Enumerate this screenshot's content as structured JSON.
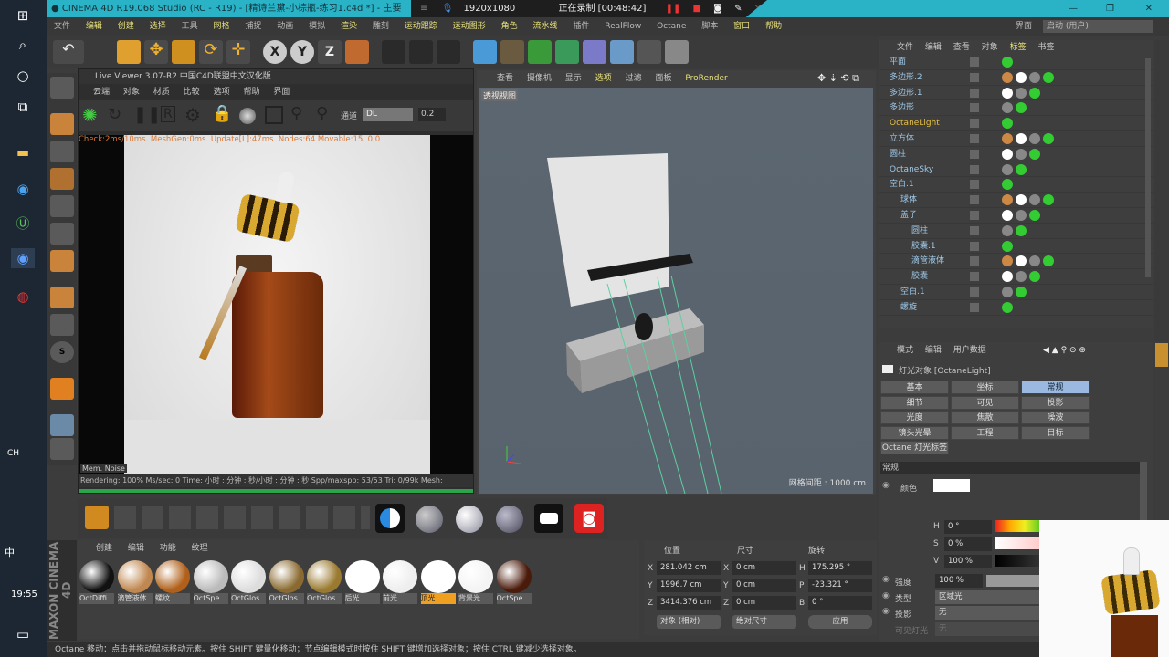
{
  "taskbar": {
    "time": "19:55",
    "ime": "中",
    "lang_hint": "CH"
  },
  "titlebar": {
    "title": "CINEMA 4D R19.068 Studio (RC - R19) - [精诗兰黛-小棕瓶-练习1.c4d *] - 主要",
    "resolution": "1920x1080",
    "recording": "正在录制 [00:48:42]"
  },
  "menu": [
    "文件",
    "编辑",
    "创建",
    "选择",
    "工具",
    "网格",
    "捕捉",
    "动画",
    "模拟",
    "渲染",
    "雕刻",
    "运动跟踪",
    "运动图形",
    "角色",
    "流水线",
    "插件",
    "RealFlow",
    "Octane",
    "脚本",
    "窗口",
    "帮助"
  ],
  "layout": {
    "label": "界面",
    "value": "启动 (用户)"
  },
  "live_viewer": {
    "title": "Live Viewer 3.07-R2 中国C4D联盟中文汉化版",
    "menu": [
      "云端",
      "对象",
      "材质",
      "比较",
      "选项",
      "帮助",
      "界面"
    ],
    "channel_label": "通道",
    "channel_value": "DL",
    "value": "0.2",
    "check": "Check:2ms/10ms. MeshGen:0ms. Update[L]:47ms. Nodes:64 Movable:15. 0 0",
    "mem_label": "Mem. Noise",
    "status": "Rendering: 100%   Ms/sec: 0   Time: 小时 : 分钟 : 秒/小时 : 分钟 : 秒   Spp/maxspp: 53/53   Tri: 0/99k   Mesh:",
    "progress": 1.0
  },
  "viewport": {
    "menu": [
      "查看",
      "摄像机",
      "显示",
      "选项",
      "过滤",
      "面板",
      "ProRender"
    ],
    "view_name": "透视视图",
    "grid": "网格间距 : 1000 cm"
  },
  "object_manager": {
    "menu": [
      "文件",
      "编辑",
      "查看",
      "对象",
      "标签",
      "书签"
    ],
    "objects": [
      {
        "name": "平面",
        "indent": 0
      },
      {
        "name": "多边形.2",
        "indent": 0
      },
      {
        "name": "多边形.1",
        "indent": 0
      },
      {
        "name": "多边形",
        "indent": 0
      },
      {
        "name": "OctaneLight",
        "indent": 0,
        "selected": true
      },
      {
        "name": "立方体",
        "indent": 0
      },
      {
        "name": "圆柱",
        "indent": 0
      },
      {
        "name": "OctaneSky",
        "indent": 0
      },
      {
        "name": "空白.1",
        "indent": 0
      },
      {
        "name": "球体",
        "indent": 1
      },
      {
        "name": "盖子",
        "indent": 1
      },
      {
        "name": "圆柱",
        "indent": 2
      },
      {
        "name": "胶囊.1",
        "indent": 2
      },
      {
        "name": "滴管液体",
        "indent": 2
      },
      {
        "name": "胶囊",
        "indent": 2
      },
      {
        "name": "空白.1",
        "indent": 1
      },
      {
        "name": "螺旋",
        "indent": 1
      }
    ]
  },
  "attribute_manager": {
    "menu": [
      "模式",
      "编辑",
      "用户数据"
    ],
    "object": "灯光对象 [OctaneLight]",
    "tabs": [
      "基本",
      "坐标",
      "常规",
      "细节",
      "可见",
      "投影",
      "光度",
      "焦散",
      "噪波",
      "镜头光晕",
      "工程",
      "目标",
      "Octane 灯光标签"
    ],
    "active_tab": "常规",
    "section": "常规",
    "color_label": "颜色",
    "h": "0 °",
    "s": "0 %",
    "v": "100 %",
    "intensity_label": "强度",
    "intensity": "100 %",
    "type_label": "类型",
    "type": "区域光",
    "shadow_label": "投影",
    "shadow": "无",
    "visible_label": "可见灯光",
    "visible": "无"
  },
  "tools_bottom": [],
  "material_manager": {
    "menu": [
      "创建",
      "编辑",
      "功能",
      "纹理"
    ],
    "materials": [
      {
        "name": "OctDiffi",
        "color": "#111"
      },
      {
        "name": "滴管液体",
        "color": "#c08850"
      },
      {
        "name": "螺纹",
        "color": "#b0601a"
      },
      {
        "name": "OctSpe",
        "color": "#bbb"
      },
      {
        "name": "OctGlos",
        "color": "#ddd"
      },
      {
        "name": "OctGlos",
        "color": "#8a6a30"
      },
      {
        "name": "OctGlos",
        "color": "#9a7a30"
      },
      {
        "name": "后光",
        "color": "#fff"
      },
      {
        "name": "前光",
        "color": "#eee"
      },
      {
        "name": "顶光",
        "color": "#fff",
        "selected": true
      },
      {
        "name": "背景光",
        "color": "#f4f4f4"
      },
      {
        "name": "OctSpe",
        "color": "#4a1a0a"
      }
    ]
  },
  "coordinates": {
    "headers": [
      "位置",
      "尺寸",
      "旋转"
    ],
    "position": {
      "X": "281.042 cm",
      "Y": "1996.7 cm",
      "Z": "3414.376 cm"
    },
    "size": {
      "X": "0 cm",
      "Y": "0 cm",
      "Z": "0 cm"
    },
    "rotation": {
      "H": "175.295 °",
      "P": "-23.321 °",
      "B": "0 °"
    },
    "mode": "对象 (相对)",
    "size_mode": "绝对尺寸",
    "apply": "应用"
  },
  "status": "Octane   移动：点击并拖动鼠标移动元素。按住 SHIFT 键量化移动；节点编辑模式时按住 SHIFT 键增加选择对象；按住 CTRL 键减少选择对象。",
  "brand": "MAXON CINEMA 4D",
  "colors": {
    "title": "#2ab3c6",
    "selected_object": "#e8c040",
    "progress": "#29a64a",
    "active_tab": "#9bb8e0"
  }
}
